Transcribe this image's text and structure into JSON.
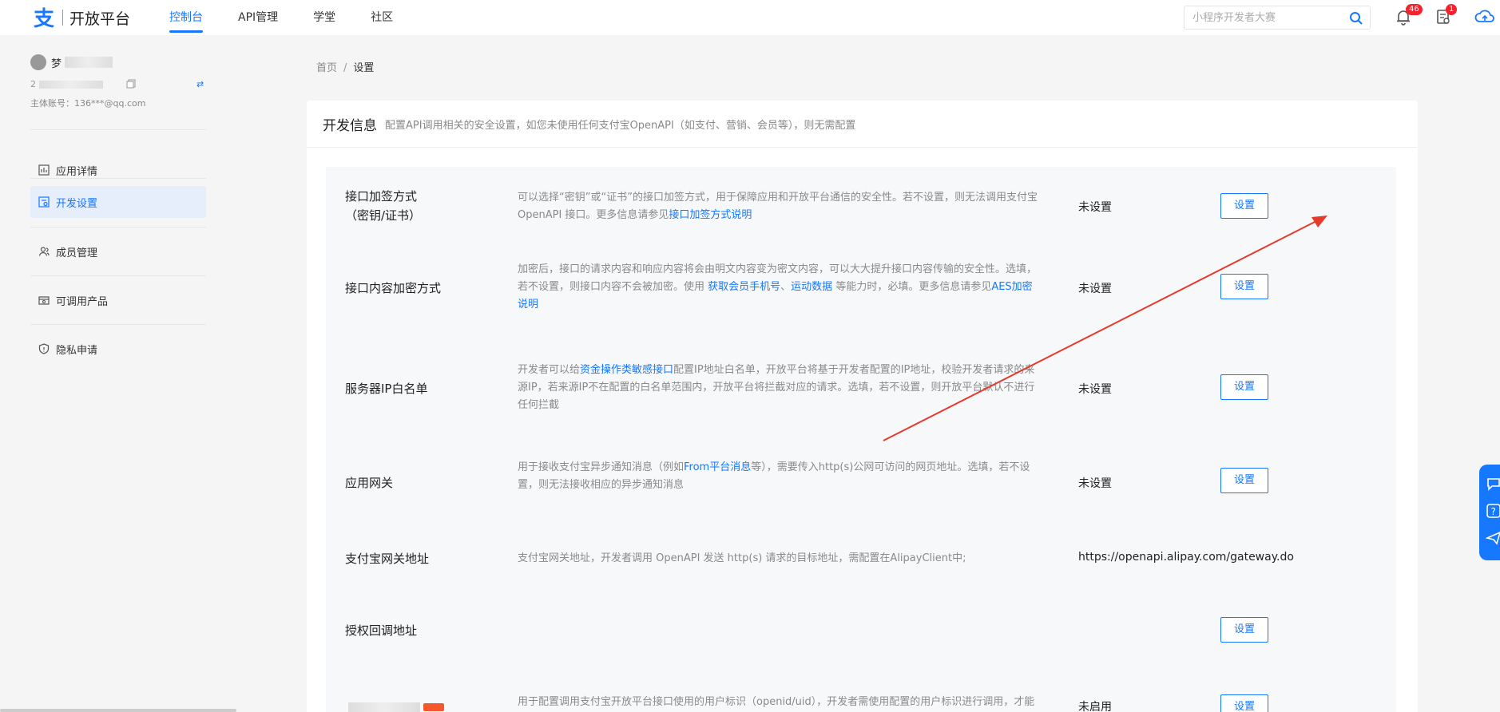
{
  "header": {
    "logo_text": "开放平台",
    "nav": [
      {
        "label": "控制台",
        "active": true
      },
      {
        "label": "API管理",
        "active": false
      },
      {
        "label": "学堂",
        "active": false
      },
      {
        "label": "社区",
        "active": false
      }
    ],
    "search_placeholder": "小程序开发者大赛",
    "notification_count": "46",
    "task_count": "1",
    "accent_color": "#1677ff"
  },
  "sidebar": {
    "user_name": "梦",
    "app_id": "2",
    "main_account": "主体账号：136***@qq.com",
    "items": [
      {
        "label": "应用详情",
        "icon": "app-detail-icon",
        "active": false
      },
      {
        "label": "开发设置",
        "icon": "dev-settings-icon",
        "active": true
      },
      {
        "label": "成员管理",
        "icon": "members-icon",
        "active": false
      },
      {
        "label": "可调用产品",
        "icon": "products-icon",
        "active": false
      },
      {
        "label": "隐私申请",
        "icon": "privacy-icon",
        "active": false
      }
    ]
  },
  "breadcrumb": {
    "home": "首页",
    "sep": "/",
    "current": "设置"
  },
  "panel": {
    "title": "开发信息",
    "description": "配置API调用相关的安全设置，如您未使用任何支付宝OpenAPI（如支付、营销、会员等），则无需配置",
    "rows": [
      {
        "label_line1": "接口加签方式",
        "label_line2": "（密钥/证书）",
        "desc_text": "可以选择“密钥”或“证书”的接口加签方式，用于保障应用和开放平台通信的安全性。若不设置，则无法调用支付宝 OpenAPI 接口。更多信息请参见",
        "desc_link": "接口加签方式说明",
        "status": "未设置",
        "button": "设置"
      },
      {
        "label_line1": "接口内容加密方式",
        "desc_text1": "加密后，接口的请求内容和响应内容将会由明文内容变为密文内容，可以大大提升接口内容传输的安全性。选填，若不设置，则接口内容不会被加密。使用 ",
        "desc_link1": "获取会员手机号",
        "desc_sep": "、",
        "desc_link2": "运动数据",
        "desc_text2": " 等能力时，必填。更多信息请参见",
        "desc_link3": "AES加密说明",
        "status": "未设置",
        "button": "设置"
      },
      {
        "label_line1": "服务器IP白名单",
        "desc_text1": "开发者可以给",
        "desc_link1": "资金操作类敏感接口",
        "desc_text2": "配置IP地址白名单，开放平台将基于开发者配置的IP地址，校验开发者请求的来源IP，若来源IP不在配置的白名单范围内，开放平台将拦截对应的请求。选填，若不设置，则开放平台默认不进行任何拦截",
        "status": "未设置",
        "button": "设置"
      },
      {
        "label_line1": "应用网关",
        "desc_text1": "用于接收支付宝异步通知消息（例如",
        "desc_link1": "From平台消息",
        "desc_text2": "等），需要传入http(s)公网可访问的网页地址。选填，若不设置，则无法接收相应的异步通知消息",
        "status": "未设置",
        "button": "设置"
      },
      {
        "label_line1": "支付宝网关地址",
        "desc_text1": "支付宝网关地址，开发者调用 OpenAPI 发送 http(s) 请求的目标地址，需配置在AlipayClient中;",
        "status": "https://openapi.alipay.com/gateway.do"
      },
      {
        "label_line1": "授权回调地址",
        "button": "设置"
      },
      {
        "desc_text1": "用于配置调用支付宝开放平台接口使用的用户标识（openid/uid），开发者需使用配置的用户标识进行调用，才能正常获",
        "status": "未启用",
        "button": "设置"
      }
    ]
  },
  "annotation": {
    "arrow_color": "#e8392d"
  }
}
